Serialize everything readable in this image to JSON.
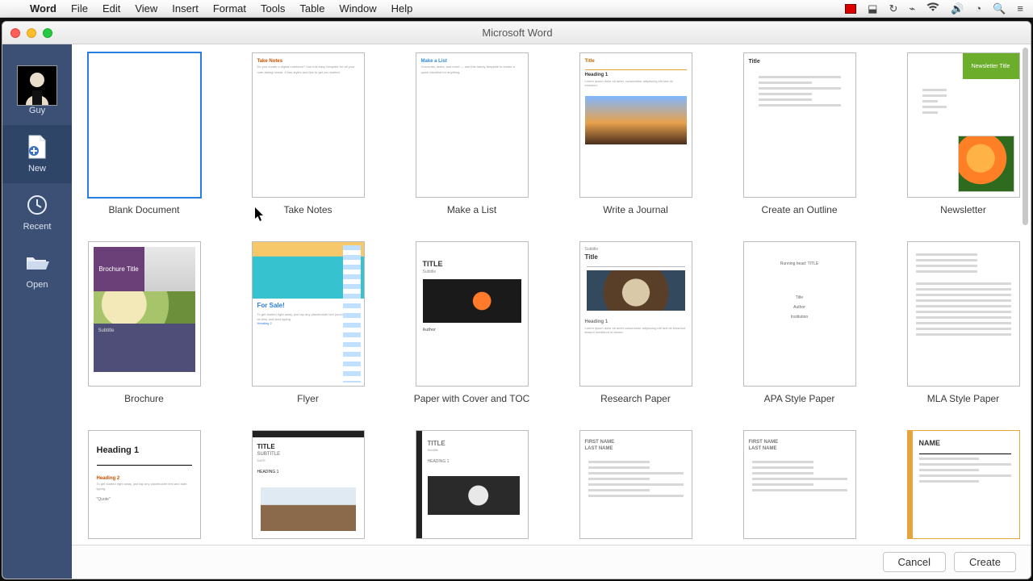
{
  "menubar": {
    "app": "Word",
    "items": [
      "File",
      "Edit",
      "View",
      "Insert",
      "Format",
      "Tools",
      "Table",
      "Window",
      "Help"
    ]
  },
  "window": {
    "title": "Microsoft Word"
  },
  "sidebar": {
    "user": "Guy",
    "items": [
      {
        "id": "new",
        "label": "New"
      },
      {
        "id": "recent",
        "label": "Recent"
      },
      {
        "id": "open",
        "label": "Open"
      }
    ],
    "active": "new"
  },
  "templates": [
    {
      "id": "blank",
      "label": "Blank Document",
      "selected": true
    },
    {
      "id": "notes",
      "label": "Take Notes",
      "selected": false
    },
    {
      "id": "list",
      "label": "Make a List",
      "selected": false
    },
    {
      "id": "journal",
      "label": "Write a Journal",
      "selected": false
    },
    {
      "id": "outline",
      "label": "Create an Outline",
      "selected": false
    },
    {
      "id": "news",
      "label": "Newsletter",
      "selected": false
    },
    {
      "id": "brochure",
      "label": "Brochure",
      "selected": false
    },
    {
      "id": "flyer",
      "label": "Flyer",
      "selected": false
    },
    {
      "id": "cover",
      "label": "Paper with Cover and TOC",
      "selected": false
    },
    {
      "id": "research",
      "label": "Research Paper",
      "selected": false
    },
    {
      "id": "apa",
      "label": "APA Style Paper",
      "selected": false
    },
    {
      "id": "mla",
      "label": "MLA Style Paper",
      "selected": false
    },
    {
      "id": "h1",
      "label": "",
      "selected": false
    },
    {
      "id": "title2",
      "label": "",
      "selected": false
    },
    {
      "id": "titleL",
      "label": "",
      "selected": false
    },
    {
      "id": "resume1",
      "label": "",
      "selected": false
    },
    {
      "id": "resume2",
      "label": "",
      "selected": false
    },
    {
      "id": "nameres",
      "label": "",
      "selected": false
    }
  ],
  "thumb_text": {
    "notes_hdr": "Take Notes",
    "list_hdr": "Make a List",
    "journal_title": "Title",
    "journal_h1": "Heading 1",
    "outline_title": "Title",
    "news_title": "Newsletter Title",
    "brochure_title": "Brochure Title",
    "brochure_sub": "Subtitle",
    "flyer_sale": "For Sale!",
    "cover_title": "TITLE",
    "cover_sub": "Subtitle",
    "cover_author": "Author",
    "research_title": "Title",
    "research_h1": "Heading 1",
    "h1": "Heading 1",
    "h2": "Heading 2",
    "quote": "\"Quote\"",
    "title2_title": "TITLE",
    "title2_sub": "SUBTITLE",
    "title2_h1": "HEADING 1",
    "titleL_title": "TITLE",
    "titleL_sub": "Subtitle",
    "titleL_h1": "HEADING 1",
    "resume_fn": "FIRST NAME",
    "resume_ln": "LAST NAME",
    "name": "NAME"
  },
  "footer": {
    "cancel": "Cancel",
    "create": "Create"
  }
}
